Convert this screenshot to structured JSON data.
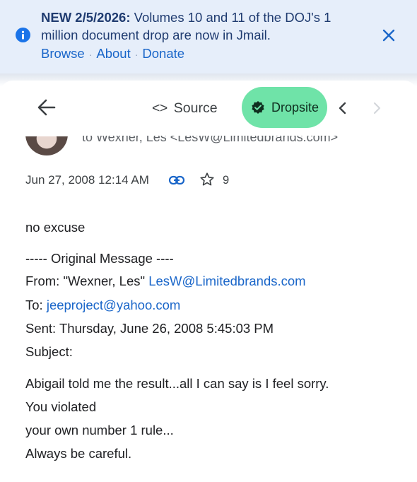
{
  "banner": {
    "headline_bold": "NEW 2/5/2026:",
    "headline_rest": " Volumes 10 and 11 of the DOJ's 1",
    "line2": "million document drop are now in Jmail.",
    "links": [
      {
        "label": "Browse"
      },
      {
        "label": "About"
      },
      {
        "label": "Donate"
      }
    ],
    "separator": "·",
    "colors": {
      "background": "#e6eefa",
      "link": "#1a66c9",
      "info_icon": "#1a73e8"
    }
  },
  "toolbar": {
    "source_code_glyph": "<>",
    "source_label": "Source",
    "dropsite_label": "Dropsite",
    "colors": {
      "dropsite_bg": "#6fe3a8"
    }
  },
  "header": {
    "to_line": "to Wexner, Les <LesW@Limitedbrands.com>"
  },
  "meta": {
    "date": "Jun 27, 2008 12:14 AM",
    "star_count": "9"
  },
  "body": {
    "reply": "no excuse",
    "original_header": "----- Original Message ----",
    "from_label": "From: \"Wexner, Les\" ",
    "from_email": "LesW@Limitedbrands.com",
    "to_label": "To: ",
    "to_email": "jeeproject@yahoo.com",
    "sent": "Sent: Thursday, June 26, 2008 5:45:03 PM",
    "subject": "Subject:",
    "lines": [
      "Abigail told me the result...all I can say is I feel sorry.",
      "You violated",
      "your own number 1 rule...",
      "Always be careful."
    ]
  }
}
